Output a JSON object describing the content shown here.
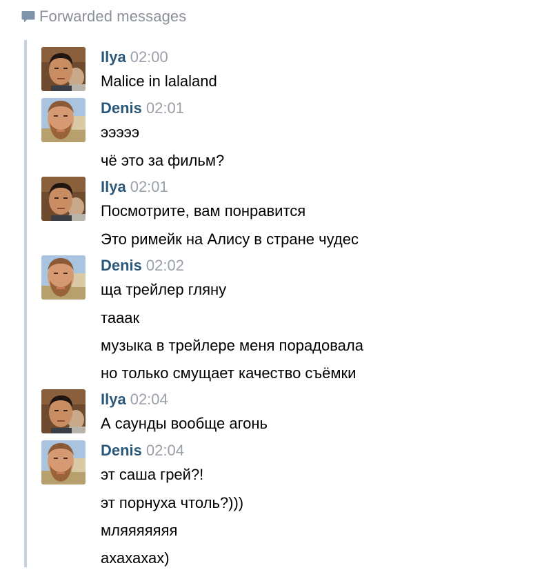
{
  "header": {
    "icon": "chat-bubble-icon",
    "title": "Forwarded messages"
  },
  "colors": {
    "author": "#2b587a",
    "time": "#9aa0a8",
    "thread_bar": "#c6d0de",
    "header_icon": "#7f93aa"
  },
  "messages": [
    {
      "author": "Ilya",
      "time": "02:00",
      "avatar": "ilya-avatar",
      "lines": [
        "Malice in lalaland"
      ]
    },
    {
      "author": "Denis",
      "time": "02:01",
      "avatar": "denis-avatar",
      "lines": [
        "эээээ",
        "чё это за фильм?"
      ]
    },
    {
      "author": "Ilya",
      "time": "02:01",
      "avatar": "ilya-avatar",
      "lines": [
        "Посмотрите, вам понравится",
        "Это римейк на Алису в стране чудес"
      ]
    },
    {
      "author": "Denis",
      "time": "02:02",
      "avatar": "denis-avatar",
      "lines": [
        "ща трейлер гляну",
        "тааак",
        "музыка в трейлере меня порадовала",
        "но только смущает качество съёмки"
      ]
    },
    {
      "author": "Ilya",
      "time": "02:04",
      "avatar": "ilya-avatar",
      "lines": [
        "А саунды вообще агонь"
      ]
    },
    {
      "author": "Denis",
      "time": "02:04",
      "avatar": "denis-avatar",
      "lines": [
        "эт саша грей?!",
        "эт порнуха чтоль?)))",
        "мляяяяяяя",
        "ахахахах)"
      ]
    }
  ]
}
